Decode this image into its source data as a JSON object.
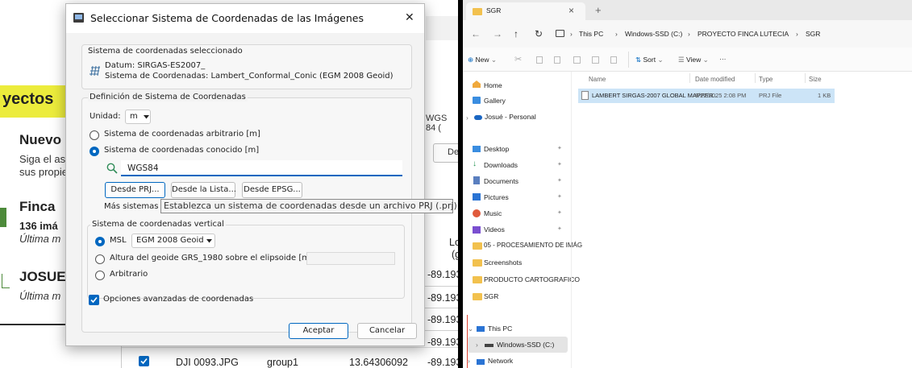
{
  "background_app": {
    "header_fragment": "yectos",
    "nuevo_title": "Nuevo",
    "nuevo_line1": "Siga el as",
    "nuevo_line2": "sus propie",
    "finca_title": "Finca",
    "finca_count": "136 imá",
    "finca_date": "Última m",
    "josue_title": "JOSUE",
    "josue_date": "Última m",
    "wgs_fragment": "WGS 84 (",
    "de_button": "De",
    "col_lo": "Lo",
    "col_lo2": "(g",
    "longitudes": [
      "-89.193",
      "-89.193",
      "-89.193",
      "-89.193",
      "-89.193"
    ],
    "last_row": {
      "file": "DJI 0093.JPG",
      "group": "group1",
      "lat": "13.64306092",
      "lon": "-89.193"
    }
  },
  "dialog": {
    "title": "Seleccionar Sistema de Coordenadas de las Imágenes",
    "close_glyph": "✕",
    "selected_group_label": "Sistema de coordenadas seleccionado",
    "datum_line": "Datum: SIRGAS-ES2007_",
    "system_line": "Sistema de Coordenadas: Lambert_Conformal_Conic (EGM 2008 Geoid)",
    "definition_group_label": "Definición de Sistema de Coordenadas",
    "unit_label": "Unidad:",
    "unit_value": "m",
    "radio_arbitrary": "Sistema de coordenadas arbitrario [m]",
    "radio_known": "Sistema de coordenadas conocido [m]",
    "search_value": "WGS84",
    "btn_prj": "Desde PRJ...",
    "btn_list": "Desde la Lista...",
    "btn_epsg": "Desde EPSG...",
    "more_systems": "Más sistemas c",
    "tooltip": "Establezca un sistema de coordenadas desde un archivo PRJ (.prj).",
    "vertical_group_label": "Sistema de coordenadas vertical",
    "msl_label": "MSL",
    "msl_value": "EGM 2008 Geoid",
    "geoid_height_label": "Altura del geoide GRS_1980 sobre el elipsoide [m]",
    "arbitrary_label": "Arbitrario",
    "advanced_label": "Opciones avanzadas de coordenadas",
    "accept_label": "Aceptar",
    "cancel_label": "Cancelar"
  },
  "explorer": {
    "tab_title": "SGR",
    "tab_close": "×",
    "tab_new": "+",
    "breadcrumb": [
      "This PC",
      "Windows-SSD (C:)",
      "PROYECTO FINCA LUTECIA",
      "SGR"
    ],
    "toolbar_new": "New",
    "toolbar_sort": "Sort",
    "toolbar_view": "View",
    "toolbar_more": "···",
    "col_name": "Name",
    "col_date": "Date modified",
    "col_type": "Type",
    "col_size": "Size",
    "file": {
      "name": "LAMBERT SIRGAS-2007 GLOBAL MAPPER...",
      "date": "8/22/2025 2:08 PM",
      "type": "PRJ File",
      "size": "1 KB"
    },
    "nav_home": "Home",
    "nav_gallery": "Gallery",
    "nav_personal": "Josué - Personal",
    "nav_desktop": "Desktop",
    "nav_downloads": "Downloads",
    "nav_documents": "Documents",
    "nav_pictures": "Pictures",
    "nav_music": "Music",
    "nav_videos": "Videos",
    "nav_folder1": "05 - PROCESAMIENTO DE IMÁG",
    "nav_folder2": "Screenshots",
    "nav_folder3": "PRODUCTO CARTOGRAFICO",
    "nav_folder4": "SGR",
    "nav_thispc": "This PC",
    "nav_drive": "Windows-SSD (C:)",
    "nav_network": "Network",
    "pin_glyph": "📌"
  }
}
